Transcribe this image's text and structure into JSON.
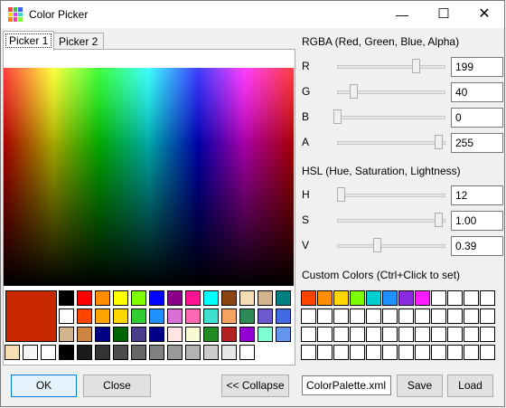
{
  "window": {
    "title": "Color Picker"
  },
  "tabs": [
    "Picker 1",
    "Picker 2"
  ],
  "current_color": "#c72800",
  "rgba": {
    "heading": "RGBA (Red, Green, Blue, Alpha)",
    "rows": [
      {
        "label": "R",
        "value": "199",
        "fraction": 0.78
      },
      {
        "label": "G",
        "value": "40",
        "fraction": 0.157
      },
      {
        "label": "B",
        "value": "0",
        "fraction": 0.0
      },
      {
        "label": "A",
        "value": "255",
        "fraction": 1.0
      }
    ]
  },
  "hsl": {
    "heading": "HSL (Hue, Saturation, Lightness)",
    "rows": [
      {
        "label": "H",
        "value": "12",
        "fraction": 0.033
      },
      {
        "label": "S",
        "value": "1.00",
        "fraction": 1.0
      },
      {
        "label": "V",
        "value": "0.39",
        "fraction": 0.39
      }
    ]
  },
  "custom_colors": {
    "heading": "Custom Colors (Ctrl+Click to set)",
    "first_row": [
      "#ff4500",
      "#ff8c00",
      "#ffd700",
      "#7cfc00",
      "#00ced1",
      "#1e90ff",
      "#8a2be2",
      "#ff1aff",
      "#ffffff",
      "#ffffff",
      "#ffffff",
      "#ffffff"
    ]
  },
  "palette": [
    [
      "#000000",
      "#ff0000",
      "#ff8c00",
      "#ffff00",
      "#7fff00",
      "#0000ff",
      "#8b008b",
      "#ff1493",
      "#00ffff",
      "#8b4513",
      "#f5deb3",
      "#d2b48c",
      "#008080"
    ],
    [
      "#ffffff",
      "#ff4500",
      "#ffa500",
      "#ffd700",
      "#32cd32",
      "#1e90ff",
      "#da70d6",
      "#ff69b4",
      "#40e0d0",
      "#f4a460",
      "#2e8b57",
      "#6a5acd",
      "#4169e1"
    ],
    [
      "#d2b48c",
      "#cd853f",
      "#000080",
      "#006400",
      "#483d8b",
      "#00008b",
      "#ffe4e1",
      "#fafad2",
      "#228b22",
      "#b22222",
      "#9400d3",
      "#7fffd4",
      "#6495ed"
    ],
    [
      "#f5deb3",
      "#f5f5f5",
      "#ffffff",
      "#000000",
      "#1a1a1a",
      "#333333",
      "#4d4d4d",
      "#666666",
      "#808080",
      "#999999",
      "#b3b3b3",
      "#cccccc",
      "#e6e6e6",
      "#ffffff"
    ]
  ],
  "buttons": {
    "ok": "OK",
    "close": "Close",
    "collapse": "<< Collapse",
    "save": "Save",
    "load": "Load"
  },
  "palette_file": "ColorPalette.xml",
  "icons": {
    "app": "palette-grid-icon",
    "minimize": "minimize-icon",
    "maximize": "maximize-icon",
    "close": "close-icon"
  }
}
